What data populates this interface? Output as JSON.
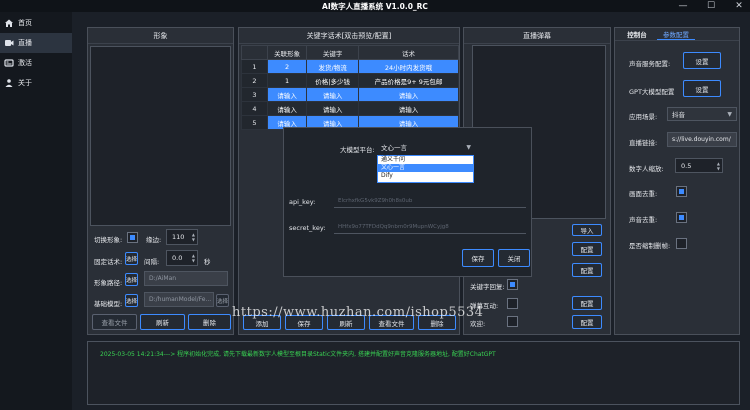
{
  "window": {
    "title": "AI数字人直播系统 V1.0.0_RC",
    "min": "—",
    "max": "☐",
    "close": "✕"
  },
  "sidebar": {
    "items": [
      {
        "label": "首页",
        "icon": "home-icon"
      },
      {
        "label": "直播",
        "icon": "live-icon"
      },
      {
        "label": "激活",
        "icon": "key-icon"
      },
      {
        "label": "关于",
        "icon": "info-icon"
      }
    ]
  },
  "avatar_panel": {
    "title": "形象",
    "switch_label": "切换形象:",
    "margin_label": "缘边:",
    "margin_value": "110",
    "fixed_label": "固定话术:",
    "fixed_btn": "选择",
    "interval_label": "间隔:",
    "interval_value": "0.0",
    "interval_unit": "秒",
    "path_label": "形象路径:",
    "path_btn": "选择",
    "path_value": "D:/AiMan",
    "base_label": "基础模型:",
    "base_btn": "选择",
    "base_value": "D:/humanModel/Fe...",
    "base_side_btn": "选择",
    "buttons": {
      "view": "查看文件",
      "refresh": "刷新",
      "delete": "删除"
    }
  },
  "keyword_panel": {
    "title": "关键字话术[双击预览/配置]",
    "columns": [
      "关联形象",
      "关键字",
      "话术"
    ],
    "rows": [
      {
        "n": "1",
        "avatar": "2",
        "keyword": "发货/物流",
        "script": "24小时内发货哦"
      },
      {
        "n": "2",
        "avatar": "1",
        "keyword": "价格|多少钱",
        "script": "产品价格是9+ 9元包邮"
      },
      {
        "n": "3",
        "avatar": "请输入",
        "keyword": "请输入",
        "script": "请输入"
      },
      {
        "n": "4",
        "avatar": "请输入",
        "keyword": "请输入",
        "script": "请输入"
      },
      {
        "n": "5",
        "avatar": "请输入",
        "keyword": "请输入",
        "script": "请输入"
      }
    ],
    "buttons": {
      "add": "添加",
      "save": "保存",
      "refresh": "刷新",
      "view": "查看文件",
      "delete": "删除"
    }
  },
  "danmu_panel": {
    "title": "直播弹幕",
    "side_buttons": [
      "导入",
      "配置",
      "配置",
      "配置",
      "配置"
    ],
    "kw_reply_label": "关键字回复:",
    "danmu_interact_label": "弹幕互动:",
    "welcome_label": "欢迎:"
  },
  "control_panel": {
    "tabs": [
      "控制台",
      "参数配置"
    ],
    "voice_label": "声音服务配置:",
    "voice_btn": "设置",
    "gpt_label": "GPT大模型配置",
    "gpt_btn": "设置",
    "scene_label": "应用场景:",
    "scene_value": "抖音",
    "link_label": "直播链接:",
    "link_value": "s://live.douyin.com/",
    "scale_label": "数字人缩放:",
    "scale_value": "0.5",
    "green_label": "画面去重:",
    "audio_label": "声音去重:",
    "record_label": "是否缩制删帧:"
  },
  "dialog": {
    "platform_label": "大模型平台:",
    "platform_value": "文心一言",
    "options": [
      "通义千问",
      "文心一言",
      "Dify"
    ],
    "selected_option": "文心一言",
    "api_key_label": "api_key:",
    "api_key_value": "ElcrhxfkG5vk9Z9h0h8s0ub",
    "secret_key_label": "secret_key:",
    "secret_key_value": "HHfx9o77TFDdQq9nbm0r9MupnWCyjg8",
    "save_btn": "保存",
    "close_btn": "关闭"
  },
  "console": {
    "line": "2025-03-05 14:21:34---> 程序初始化完成, 请先下载最新数字人模型至根目录Static文件夹内, 搭建并配置好声音克隆服务器地址, 配置好ChatGPT"
  },
  "watermark": "https://www.huzhan.com/ishop5534",
  "colors": {
    "accent": "#3d8bff",
    "bg": "#1b2028",
    "panel": "#2a2f37",
    "log": "#39d353"
  }
}
